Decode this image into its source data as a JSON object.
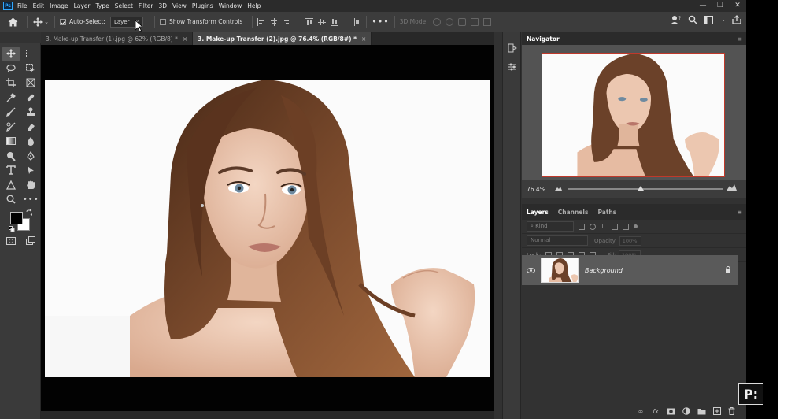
{
  "menubar": {
    "app_logo": "Ps",
    "items": [
      "File",
      "Edit",
      "Image",
      "Layer",
      "Type",
      "Select",
      "Filter",
      "3D",
      "View",
      "Plugins",
      "Window",
      "Help"
    ],
    "window_controls": [
      "—",
      "❐",
      "✕"
    ]
  },
  "options": {
    "auto_select_label": "Auto-Select:",
    "auto_select_checked": true,
    "auto_select_target": "Layer",
    "transform_controls_label": "Show Transform Controls",
    "more_label": "•••",
    "mode_3d_label": "3D Mode:"
  },
  "tabs": [
    {
      "label": "3. Make-up Transfer (1).jpg @ 62% (RGB/8) *",
      "active": false
    },
    {
      "label": "3. Make-up Transfer (2).jpg @ 76.4% (RGB/8#) *",
      "active": true
    }
  ],
  "tab_close": "×",
  "navigator": {
    "title": "Navigator",
    "zoom": "76.4%",
    "zoom_slider_fraction": 0.47
  },
  "layers_panel": {
    "tabs": [
      "Layers",
      "Channels",
      "Paths"
    ],
    "kind_placeholder": "Kind",
    "blend_mode": "Normal",
    "opacity_label": "Opacity:",
    "opacity_value": "100%",
    "lock_label": "Lock:",
    "fill_label": "Fill:",
    "fill_value": "100%",
    "layer": {
      "name": "Background",
      "visible": true,
      "locked": true
    }
  },
  "panel_menu": "≡",
  "watermark": "P:",
  "colors": {
    "foreground": "#000000",
    "background": "#ffffff",
    "hair": "#6b4129",
    "skin": "#e9c4ad"
  }
}
